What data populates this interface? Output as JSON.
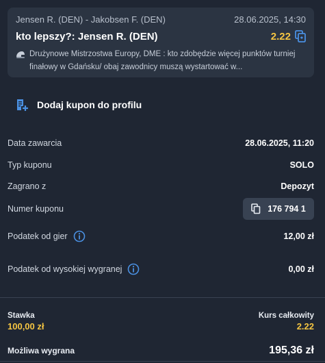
{
  "bet": {
    "match": "Jensen R. (DEN) - Jakobsen F. (DEN)",
    "datetime": "28.06.2025, 14:30",
    "selection": "kto lepszy?: Jensen R. (DEN)",
    "odds": "2.22",
    "description": "Drużynowe Mistrzostwa Europy, DME : kto zdobędzie więcej punktów turniej finałowy w Gdańsku/ obaj zawodnicy muszą wystartować w...",
    "icons": {
      "odds": "copy-swap-icon",
      "event": "speedway-helmet-icon"
    }
  },
  "add_coupon": {
    "label": "Dodaj kupon do profilu",
    "icon": "add-to-list-icon"
  },
  "details": {
    "date_label": "Data zawarcia",
    "date_value": "28.06.2025, 11:20",
    "type_label": "Typ kuponu",
    "type_value": "SOLO",
    "played_label": "Zagrano z",
    "played_value": "Depozyt",
    "number_label": "Numer kuponu",
    "number_value": "176 794 1",
    "tax_label": "Podatek od gier",
    "tax_value": "12,00 zł",
    "hightax_label": "Podatek od wysokiej wygranej",
    "hightax_value": "0,00 zł"
  },
  "summary": {
    "stake_label": "Stawka",
    "stake_value": "100,00 zł",
    "total_odds_label": "Kurs całkowity",
    "total_odds_value": "2.22",
    "win_label": "Możliwa wygrana",
    "win_value": "195,36 zł"
  },
  "colors": {
    "background": "#1f2633",
    "card": "#2b3442",
    "accent": "#f5c542",
    "icon_blue": "#4a90e2"
  }
}
